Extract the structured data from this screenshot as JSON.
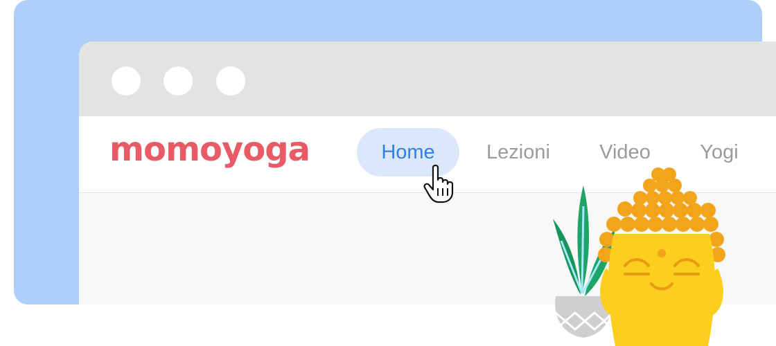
{
  "window": {
    "controls": [
      "window-dot",
      "window-dot",
      "window-dot"
    ]
  },
  "brand": {
    "logo_text": "momoyoga",
    "color": "#e85a66"
  },
  "nav": {
    "items": [
      {
        "label": "Home",
        "active": true
      },
      {
        "label": "Lezioni",
        "active": false
      },
      {
        "label": "Video",
        "active": false
      },
      {
        "label": "Yogi",
        "active": false
      }
    ],
    "active_color": "#2f80e8",
    "active_bg": "#dbe8fb",
    "inactive_color": "#9a9a9a"
  },
  "cursor": {
    "icon": "pointer-hand-icon"
  },
  "illustration": {
    "icons": [
      "buddha-head-icon",
      "potted-plant-icon"
    ]
  },
  "colors": {
    "backdrop": "#aecffa",
    "titlebar": "#e3e3e3",
    "buddha": "#fccf1e",
    "hair": "#f2a41b",
    "plant": "#1fa468"
  }
}
